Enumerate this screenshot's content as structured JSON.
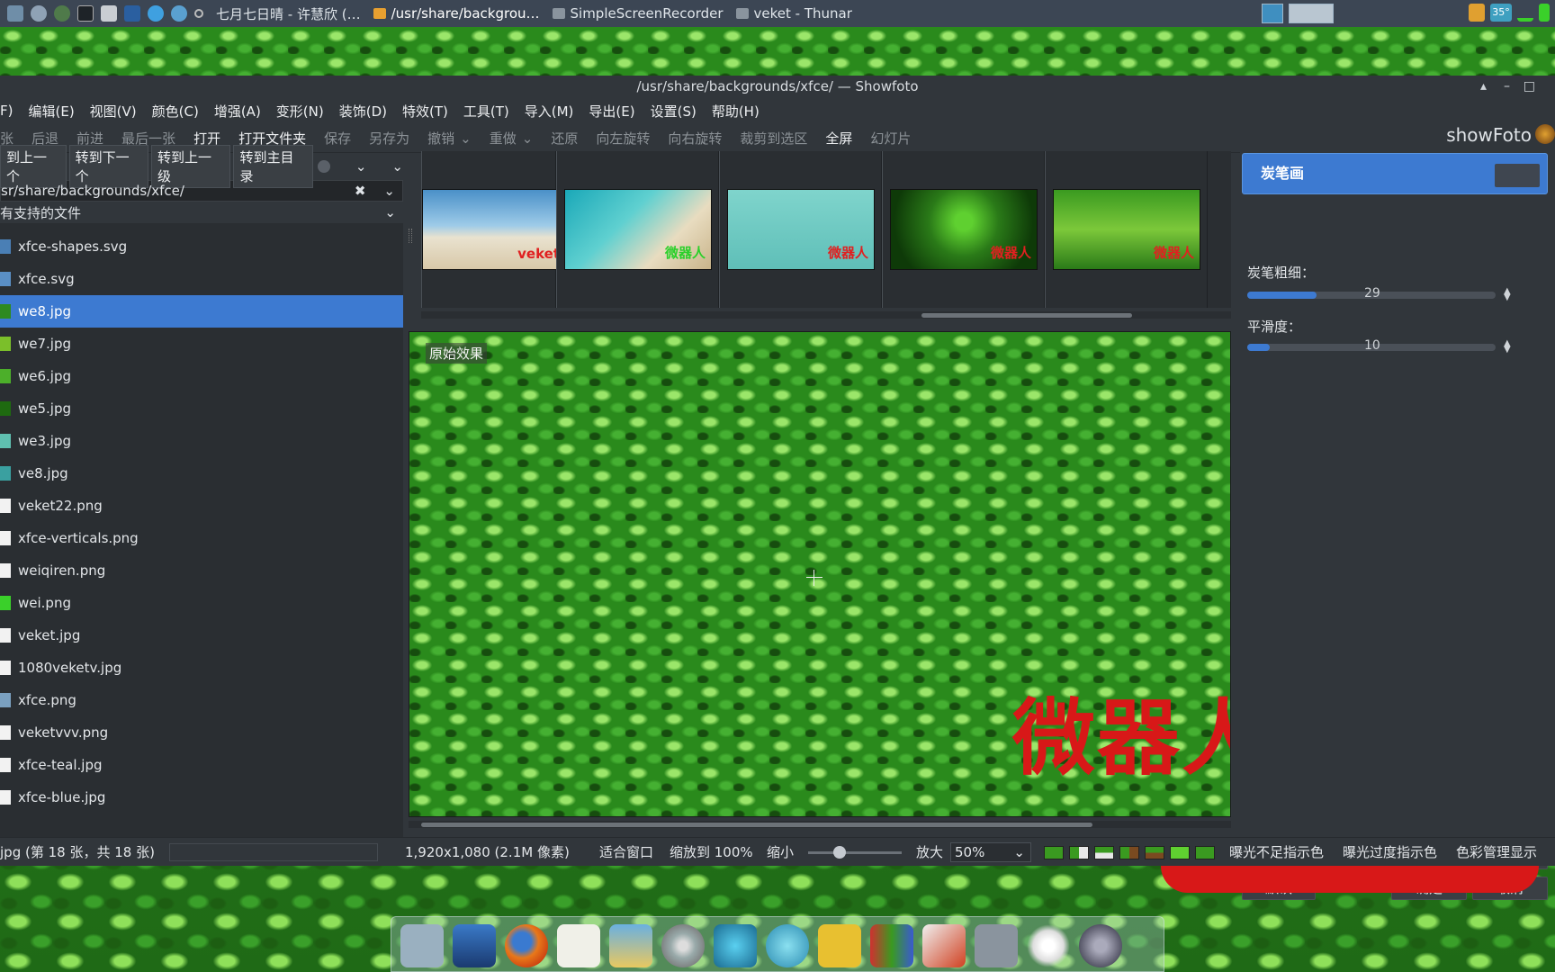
{
  "taskbar": {
    "tasks": [
      {
        "label": "七月七日晴 - 许慧欣 (…",
        "active": false
      },
      {
        "label": "/usr/share/backgrou…",
        "active": true
      },
      {
        "label": "SimpleScreenRecorder",
        "active": false
      },
      {
        "label": "veket - Thunar",
        "active": false
      }
    ],
    "tray_temp": "35°"
  },
  "window": {
    "title": "/usr/share/backgrounds/xfce/ — Showfoto"
  },
  "menu": [
    "F)",
    "编辑(E)",
    "视图(V)",
    "颜色(C)",
    "增强(A)",
    "变形(N)",
    "装饰(D)",
    "特效(T)",
    "工具(T)",
    "导入(M)",
    "导出(E)",
    "设置(S)",
    "帮助(H)"
  ],
  "toolbar": [
    {
      "label": "张",
      "enabled": false
    },
    {
      "label": "后退",
      "enabled": false
    },
    {
      "label": "前进",
      "enabled": false
    },
    {
      "label": "最后一张",
      "enabled": false
    },
    {
      "label": "打开",
      "enabled": true
    },
    {
      "label": "打开文件夹",
      "enabled": true
    },
    {
      "label": "保存",
      "enabled": false
    },
    {
      "label": "另存为",
      "enabled": false
    },
    {
      "label": "撤销",
      "enabled": false
    },
    {
      "label": "重做",
      "enabled": false
    },
    {
      "label": "还原",
      "enabled": false
    },
    {
      "label": "向左旋转",
      "enabled": false
    },
    {
      "label": "向右旋转",
      "enabled": false
    },
    {
      "label": "裁剪到选区",
      "enabled": false
    },
    {
      "label": "全屏",
      "enabled": true
    },
    {
      "label": "幻灯片",
      "enabled": false
    }
  ],
  "logo": "showFoto",
  "nav": {
    "buttons": [
      "到上一个",
      "转到下一个",
      "转到上一级",
      "转到主目录"
    ],
    "path": "sr/share/backgrounds/xfce/",
    "filter": "有支持的文件"
  },
  "files": [
    {
      "name": "xfce-shapes.svg",
      "color": "#4a7fb5"
    },
    {
      "name": "xfce.svg",
      "color": "#5a8fc5"
    },
    {
      "name": "we8.jpg",
      "color": "#2e8a20",
      "selected": true
    },
    {
      "name": "we7.jpg",
      "color": "#7bbf2a"
    },
    {
      "name": "we6.jpg",
      "color": "#4caf2a"
    },
    {
      "name": "we5.jpg",
      "color": "#1e6a10"
    },
    {
      "name": "we3.jpg",
      "color": "#5fc0b0"
    },
    {
      "name": "ve8.jpg",
      "color": "#3aa0a0"
    },
    {
      "name": "veket22.png",
      "color": "#f2f2f2"
    },
    {
      "name": "xfce-verticals.png",
      "color": "#f2f2f2"
    },
    {
      "name": "weiqiren.png",
      "color": "#f2f2f2"
    },
    {
      "name": "wei.png",
      "color": "#3ad02a"
    },
    {
      "name": "veket.jpg",
      "color": "#f2f2f2"
    },
    {
      "name": "1080veketv.jpg",
      "color": "#f2f2f2"
    },
    {
      "name": "xfce.png",
      "color": "#7aa0c0"
    },
    {
      "name": "veketvvv.png",
      "color": "#f2f2f2"
    },
    {
      "name": "xfce-teal.jpg",
      "color": "#f2f2f2"
    },
    {
      "name": "xfce-blue.jpg",
      "color": "#f2f2f2"
    }
  ],
  "thumbs": [
    {
      "label": "veket",
      "bg": "linear-gradient(#4a90c8 0%,#9ecbe8 45%,#e9e2cf 60%,#d8c8a8 100%)",
      "color": "#e02020"
    },
    {
      "label": "微器人",
      "bg": "linear-gradient(135deg,#1aa8b8 0%,#5fd0d0 40%,#e8dcc0 70%,#c9b48a 100%)",
      "color": "#2ad02a"
    },
    {
      "label": "微器人",
      "bg": "linear-gradient(#7fd4cc,#5fbfb8)",
      "color": "#e02020"
    },
    {
      "label": "微器人",
      "bg": "radial-gradient(circle at 50% 40%,#5fd030 10%,#2a7a18 40%,#0e3a08 80%)",
      "color": "#e02020"
    },
    {
      "label": "微器人",
      "bg": "linear-gradient(#3a9a20,#7cc83a 50%,#2a7a18)",
      "color": "#e02020"
    }
  ],
  "canvas": {
    "label": "原始效果",
    "watermark": "微器人"
  },
  "tool": {
    "name": "炭笔画",
    "pencil_label": "炭笔粗细：",
    "pencil_value": "29",
    "pencil_fraction": 0.28,
    "smooth_label": "平滑度：",
    "smooth_value": "10",
    "smooth_fraction": 0.09,
    "buttons": {
      "try": "试用",
      "default": "默认",
      "ok": "确定",
      "cancel": "取消"
    }
  },
  "status": {
    "file": "jpg (第 18 张，共 18 张)",
    "dims": "1,920x1,080 (2.1M 像素)",
    "fit": "适合窗口",
    "zoom100": "缩放到 100%",
    "zoomout": "缩小",
    "zoomin": "放大",
    "zoom": "50%",
    "under": "曝光不足指示色",
    "over": "曝光过度指示色",
    "cm": "色彩管理显示"
  }
}
